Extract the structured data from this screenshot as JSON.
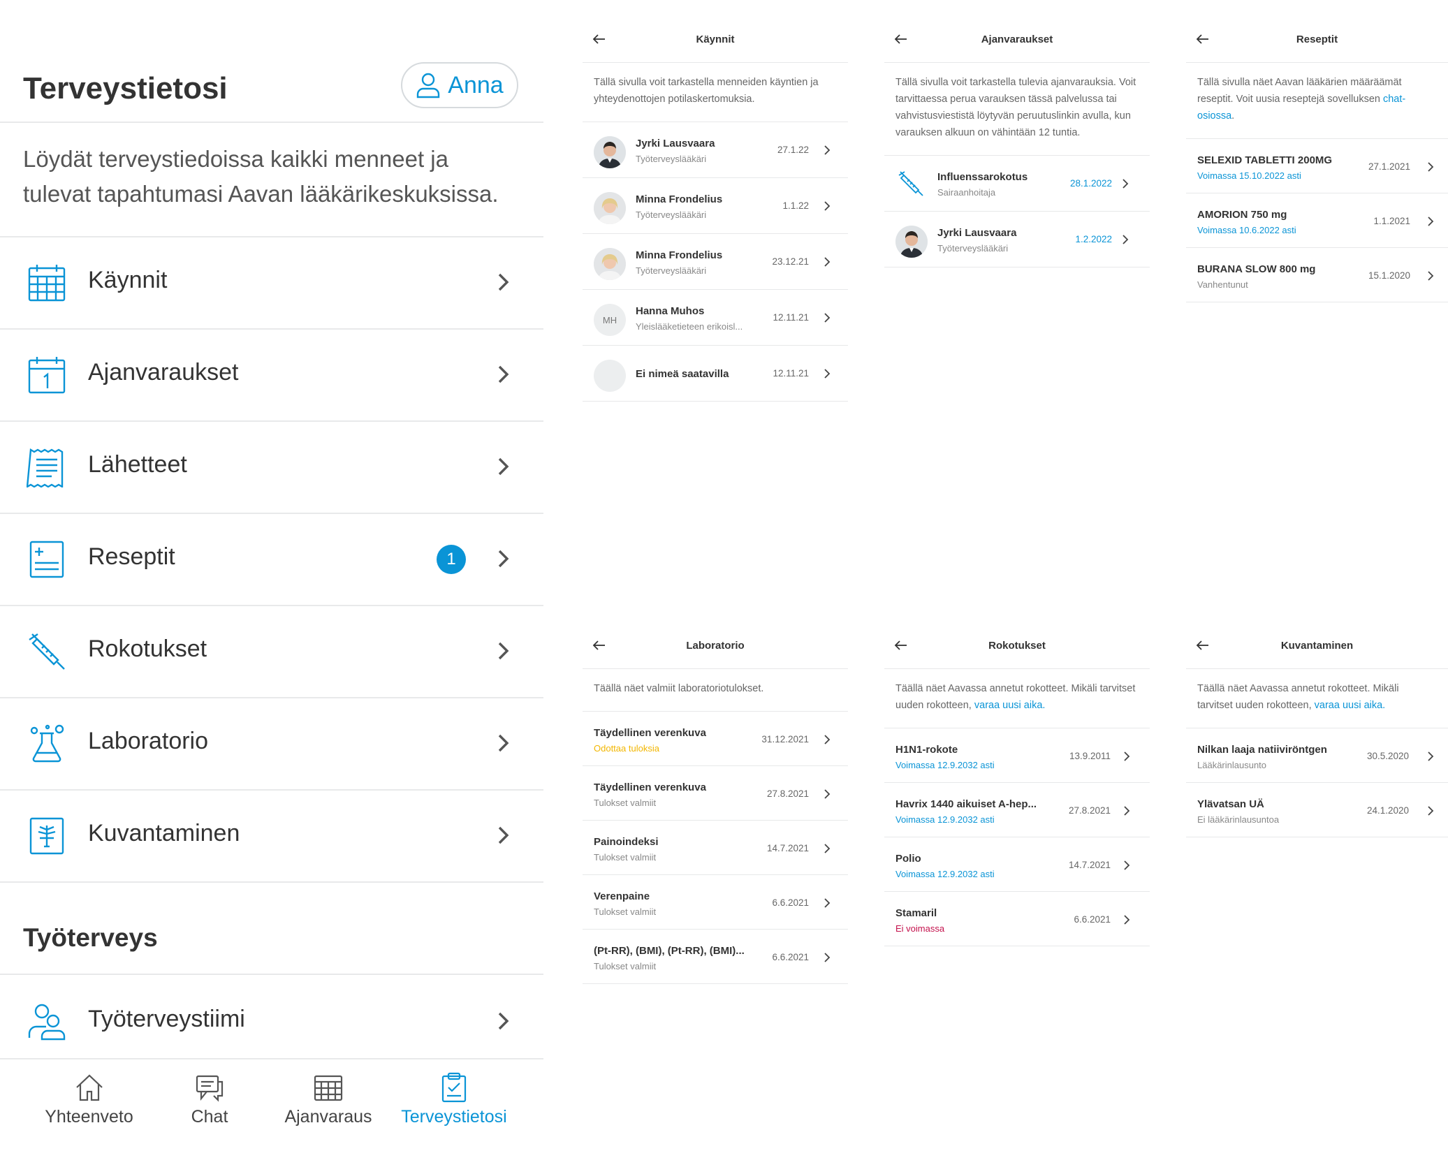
{
  "main": {
    "title": "Terveystietosi",
    "profile_name": "Anna",
    "intro": "Löydät terveystiedoissa kaikki menneet ja tulevat tapahtumasi Aavan lääkärikeskuksissa.",
    "menu": [
      {
        "label": "Käynnit",
        "icon": "calendar-grid-icon"
      },
      {
        "label": "Ajanvaraukset",
        "icon": "calendar-day-icon"
      },
      {
        "label": "Lähetteet",
        "icon": "receipt-icon"
      },
      {
        "label": "Reseptit",
        "icon": "prescription-icon",
        "badge": "1"
      },
      {
        "label": "Rokotukset",
        "icon": "syringe-icon"
      },
      {
        "label": "Laboratorio",
        "icon": "flask-icon"
      },
      {
        "label": "Kuvantaminen",
        "icon": "xray-icon"
      }
    ],
    "section_title": "Työterveys",
    "section_items": [
      {
        "label": "Työterveystiimi",
        "icon": "team-icon"
      }
    ],
    "bottom_nav": [
      {
        "label": "Yhteenveto",
        "icon": "home-icon"
      },
      {
        "label": "Chat",
        "icon": "chat-icon"
      },
      {
        "label": "Ajanvaraus",
        "icon": "calendar-icon"
      },
      {
        "label": "Terveystietosi",
        "icon": "clipboard-icon",
        "active": true
      }
    ],
    "accent_color": "#0a94d6"
  },
  "kaynnit": {
    "title": "Käynnit",
    "description": "Tällä sivulla voit tarkastella menneiden käyntien ja yhteydenottojen potilaskertomuksia.",
    "rows": [
      {
        "name": "Jyrki Lausvaara",
        "sub": "Työterveyslääkäri",
        "date": "27.1.22"
      },
      {
        "name": "Minna Frondelius",
        "sub": "Työterveyslääkäri",
        "date": "1.1.22"
      },
      {
        "name": "Minna Frondelius",
        "sub": "Työterveyslääkäri",
        "date": "23.12.21"
      },
      {
        "name": "Hanna Muhos",
        "sub": "Yleislääketieteen erikoisl...",
        "date": "12.11.21",
        "initials": "MH"
      },
      {
        "name": "Ei nimeä saatavilla",
        "sub": "",
        "date": "12.11.21"
      }
    ]
  },
  "ajanvaraukset": {
    "title": "Ajanvaraukset",
    "description": "Tällä sivulla voit tarkastella tulevia ajanvarauksia. Voit tarvittaessa perua varauksen tässä palvelussa tai vahvistusviestistä löytyvän peruutuslinkin avulla, kun varauksen alkuun on vähintään 12 tuntia.",
    "rows": [
      {
        "name": "Influenssarokotus",
        "sub": "Sairaanhoitaja",
        "date": "28.1.2022"
      },
      {
        "name": "Jyrki Lausvaara",
        "sub": "Työterveyslääkäri",
        "date": "1.2.2022"
      }
    ]
  },
  "reseptit": {
    "title": "Reseptit",
    "description_pre": "Tällä sivulla näet Aavan lääkärien määräämät reseptit. Voit uusia reseptejä sovelluksen ",
    "description_link": "chat-osiossa",
    "description_post": ".",
    "rows": [
      {
        "name": "SELEXID TABLETTI 200MG",
        "sub": "Voimassa 15.10.2022 asti",
        "date": "27.1.2021",
        "status": "blue"
      },
      {
        "name": "AMORION 750 mg",
        "sub": "Voimassa 10.6.2022 asti",
        "date": "1.1.2021",
        "status": "blue"
      },
      {
        "name": "BURANA SLOW 800 mg",
        "sub": "Vanhentunut",
        "date": "15.1.2020",
        "status": "grey"
      }
    ]
  },
  "laboratorio": {
    "title": "Laboratorio",
    "description": "Täällä näet valmiit laboratoriotulokset.",
    "rows": [
      {
        "name": "Täydellinen verenkuva",
        "sub": "Odottaa tuloksia",
        "date": "31.12.2021",
        "status": "yellow"
      },
      {
        "name": "Täydellinen verenkuva",
        "sub": "Tulokset valmiit",
        "date": "27.8.2021",
        "status": "grey"
      },
      {
        "name": "Painoindeksi",
        "sub": "Tulokset valmiit",
        "date": "14.7.2021",
        "status": "grey"
      },
      {
        "name": "Verenpaine",
        "sub": "Tulokset valmiit",
        "date": "6.6.2021",
        "status": "grey"
      },
      {
        "name": "(Pt-RR), (BMI), (Pt-RR), (BMI)...",
        "sub": "Tulokset valmiit",
        "date": "6.6.2021",
        "status": "grey"
      }
    ]
  },
  "rokotukset": {
    "title": "Rokotukset",
    "description_pre": "Täällä näet Aavassa annetut rokotteet. Mikäli tarvitset uuden rokotteen, ",
    "description_link": "varaa uusi aika.",
    "rows": [
      {
        "name": "H1N1-rokote",
        "sub": "Voimassa 12.9.2032 asti",
        "date": "13.9.2011",
        "status": "blue"
      },
      {
        "name": "Havrix 1440 aikuiset A-hep...",
        "sub": "Voimassa 12.9.2032 asti",
        "date": "27.8.2021",
        "status": "blue"
      },
      {
        "name": "Polio",
        "sub": "Voimassa 12.9.2032 asti",
        "date": "14.7.2021",
        "status": "blue"
      },
      {
        "name": "Stamaril",
        "sub": "Ei voimassa",
        "date": "6.6.2021",
        "status": "red"
      }
    ]
  },
  "kuvantaminen": {
    "title": "Kuvantaminen",
    "description_pre": "Täällä näet Aavassa annetut rokotteet. Mikäli tarvitset uuden rokotteen, ",
    "description_link": "varaa uusi aika.",
    "rows": [
      {
        "name": "Nilkan laaja natiiviröntgen",
        "sub": "Lääkärinlausunto",
        "date": "30.5.2020",
        "status": "grey"
      },
      {
        "name": "Ylävatsan UÄ",
        "sub": "Ei lääkärinlausuntoa",
        "date": "24.1.2020",
        "status": "grey"
      }
    ]
  }
}
